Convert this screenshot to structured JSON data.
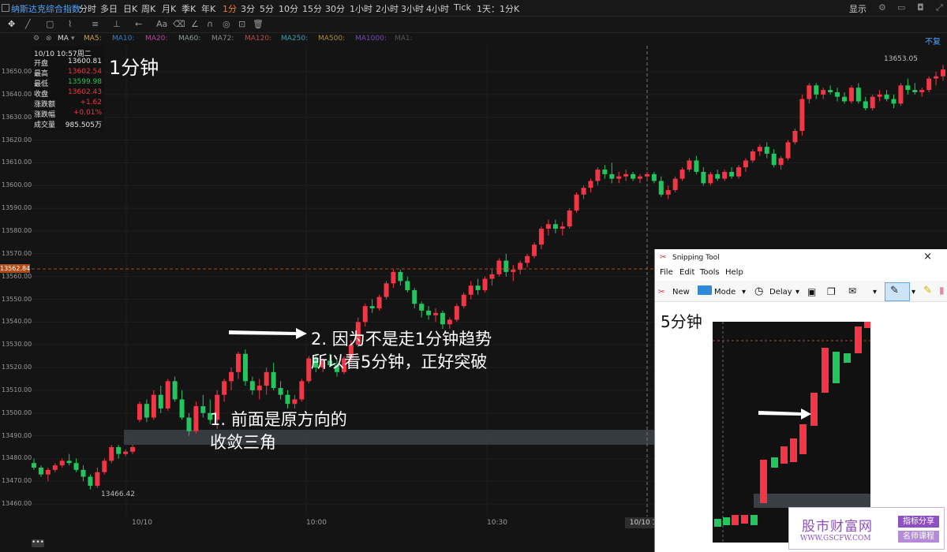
{
  "topbar": {
    "symbol": "纳斯达克综合指数",
    "timeframes": [
      "分时",
      "多日",
      "日K",
      "周K",
      "月K",
      "季K",
      "年K",
      "1分",
      "3分",
      "5分",
      "10分",
      "15分",
      "30分",
      "1小时",
      "2小时",
      "3小时",
      "4小时",
      "Tick",
      "1天：1分K"
    ],
    "active_timeframe": "1分",
    "show_label": "显示"
  },
  "mabar": {
    "indicator": "MA",
    "items": [
      {
        "label": "MA5:",
        "color": "#c8a24a"
      },
      {
        "label": "MA10:",
        "color": "#3d7fb8"
      },
      {
        "label": "MA20:",
        "color": "#b04a9a"
      },
      {
        "label": "MA60:",
        "color": "#8aa0a0"
      },
      {
        "label": "MA72:",
        "color": "#8a8a8a"
      },
      {
        "label": "MA120:",
        "color": "#b05050"
      },
      {
        "label": "MA250:",
        "color": "#3da0b0"
      },
      {
        "label": "MA500:",
        "color": "#b08a30"
      },
      {
        "label": "MA1000:",
        "color": "#7a4ab0"
      },
      {
        "label": "MA1:",
        "color": "#555555"
      }
    ],
    "right_label": "不复"
  },
  "info": {
    "date": "10/10 10:57周二",
    "rows": [
      {
        "k": "开盘",
        "v": "13600.81",
        "color": "#e6e6e6"
      },
      {
        "k": "最高",
        "v": "13602.54",
        "color": "#f23645"
      },
      {
        "k": "最低",
        "v": "13599.98",
        "color": "#22c55e"
      },
      {
        "k": "收盘",
        "v": "13602.43",
        "color": "#f23645"
      },
      {
        "k": "涨跌额",
        "v": "+1.62",
        "color": "#f23645"
      },
      {
        "k": "涨跌幅",
        "v": "+0.01%",
        "color": "#f23645"
      },
      {
        "k": "成交量",
        "v": "985.505万",
        "color": "#e6e6e6"
      }
    ]
  },
  "chart_title": "1分钟",
  "yaxis": {
    "ticks": [
      "13650.00",
      "13640.00",
      "13630.00",
      "13620.00",
      "13610.00",
      "13600.00",
      "13590.00",
      "13580.00",
      "13570.00",
      "13560.00",
      "13550.00",
      "13540.00",
      "13530.00",
      "13520.00",
      "13510.00",
      "13500.00",
      "13490.00",
      "13480.00",
      "13470.00",
      "13460.00"
    ],
    "current_price": "13562.84"
  },
  "xaxis": {
    "ticks": [
      "10/10",
      "10:00",
      "10:30"
    ],
    "cursor_label": "10/10 1"
  },
  "low_label": "13466.42",
  "high_label": "13653.05",
  "annotations": {
    "a1_line1": "1. 前面是原方向的",
    "a1_line2": "收敛三角",
    "a2_line1": "2. 因为不是走1分钟趋势",
    "a2_line2": "所以看5分钟，正好突破"
  },
  "snipping_tool": {
    "title": "Snipping Tool",
    "menus": [
      "File",
      "Edit",
      "Tools",
      "Help"
    ],
    "buttons": [
      "New",
      "Mode",
      "Delay"
    ],
    "label": "5分钟"
  },
  "watermark": {
    "name": "股市财富网",
    "url": "WWW.GSCFW.COM",
    "tag1": "指标分享",
    "tag2": "名师课程"
  },
  "chart_data": {
    "type": "candlestick",
    "title": "1分钟",
    "ylim": [
      13455,
      13661
    ],
    "up_color": "#f23645",
    "down_color": "#22c55e",
    "candles": [
      [
        13478,
        13480,
        13475,
        13476
      ],
      [
        13476,
        13477,
        13472,
        13473
      ],
      [
        13473,
        13476,
        13470,
        13475
      ],
      [
        13475,
        13478,
        13474,
        13477
      ],
      [
        13477,
        13480,
        13476,
        13479
      ],
      [
        13479,
        13482,
        13477,
        13478
      ],
      [
        13478,
        13480,
        13474,
        13475
      ],
      [
        13475,
        13477,
        13470,
        13472
      ],
      [
        13472,
        13473,
        13466.42,
        13468
      ],
      [
        13468,
        13476,
        13467,
        13474
      ],
      [
        13474,
        13480,
        13473,
        13479
      ],
      [
        13479,
        13486,
        13478,
        13485
      ],
      [
        13485,
        13486,
        13480,
        13482
      ],
      [
        13482,
        13484,
        13481,
        13483
      ],
      [
        13483,
        13486,
        13482,
        13485
      ],
      [
        13497,
        13505,
        13496,
        13504
      ],
      [
        13504,
        13506,
        13496,
        13498
      ],
      [
        13498,
        13510,
        13497,
        13508
      ],
      [
        13508,
        13512,
        13500,
        13502
      ],
      [
        13502,
        13515,
        13501,
        13514
      ],
      [
        13514,
        13516,
        13505,
        13506
      ],
      [
        13506,
        13510,
        13497,
        13498
      ],
      [
        13498,
        13500,
        13490,
        13492
      ],
      [
        13492,
        13505,
        13491,
        13503
      ],
      [
        13503,
        13508,
        13498,
        13500
      ],
      [
        13500,
        13506,
        13495,
        13497
      ],
      [
        13497,
        13510,
        13493,
        13508
      ],
      [
        13508,
        13515,
        13505,
        13514
      ],
      [
        13514,
        13520,
        13510,
        13518
      ],
      [
        13518,
        13527,
        13515,
        13526
      ],
      [
        13526,
        13528,
        13512,
        13514
      ],
      [
        13514,
        13516,
        13508,
        13510
      ],
      [
        13510,
        13515,
        13506,
        13512
      ],
      [
        13512,
        13520,
        13508,
        13518
      ],
      [
        13518,
        13522,
        13510,
        13511
      ],
      [
        13511,
        13514,
        13506,
        13508
      ],
      [
        13508,
        13510,
        13502,
        13504
      ],
      [
        13504,
        13508,
        13502,
        13506
      ],
      [
        13506,
        13515,
        13505,
        13514
      ],
      [
        13514,
        13525,
        13513,
        13524
      ],
      [
        13524,
        13526,
        13518,
        13520
      ],
      [
        13520,
        13524,
        13518,
        13523
      ],
      [
        13523,
        13526,
        13520,
        13521
      ],
      [
        13521,
        13524,
        13516,
        13518
      ],
      [
        13518,
        13525,
        13517,
        13524
      ],
      [
        13524,
        13532,
        13522,
        13530
      ],
      [
        13530,
        13542,
        13529,
        13540
      ],
      [
        13540,
        13548,
        13538,
        13547
      ],
      [
        13547,
        13550,
        13544,
        13546
      ],
      [
        13546,
        13552,
        13545,
        13551
      ],
      [
        13551,
        13558,
        13550,
        13557
      ],
      [
        13557,
        13563,
        13555,
        13562
      ],
      [
        13562,
        13563,
        13556,
        13558
      ],
      [
        13558,
        13560,
        13553,
        13554
      ],
      [
        13554,
        13555,
        13546,
        13548
      ],
      [
        13548,
        13549,
        13542,
        13545
      ],
      [
        13545,
        13547,
        13541,
        13543
      ],
      [
        13543,
        13546,
        13540,
        13544
      ],
      [
        13544,
        13545,
        13537,
        13539
      ],
      [
        13539,
        13542,
        13537,
        13541
      ],
      [
        13541,
        13548,
        13540,
        13547
      ],
      [
        13547,
        13553,
        13546,
        13552
      ],
      [
        13552,
        13558,
        13550,
        13556
      ],
      [
        13556,
        13559,
        13552,
        13554
      ],
      [
        13554,
        13560,
        13553,
        13559
      ],
      [
        13559,
        13563,
        13556,
        13561
      ],
      [
        13561,
        13568,
        13560,
        13567
      ],
      [
        13567,
        13570,
        13560,
        13562
      ],
      [
        13562,
        13565,
        13558,
        13563
      ],
      [
        13563,
        13567,
        13561,
        13566
      ],
      [
        13566,
        13570,
        13564,
        13569
      ],
      [
        13569,
        13575,
        13568,
        13574
      ],
      [
        13574,
        13582,
        13572,
        13581
      ],
      [
        13581,
        13585,
        13578,
        13583
      ],
      [
        13583,
        13585,
        13579,
        13581
      ],
      [
        13581,
        13584,
        13578,
        13582
      ],
      [
        13582,
        13590,
        13581,
        13589
      ],
      [
        13589,
        13597,
        13588,
        13596
      ],
      [
        13596,
        13600,
        13594,
        13599
      ],
      [
        13599,
        13603,
        13597,
        13602
      ],
      [
        13602,
        13608,
        13600,
        13607
      ],
      [
        13607,
        13609,
        13603,
        13605
      ],
      [
        13605,
        13610,
        13601,
        13603
      ],
      [
        13603,
        13606,
        13601,
        13604
      ],
      [
        13604,
        13607,
        13602,
        13605
      ],
      [
        13605,
        13606,
        13602,
        13603
      ],
      [
        13603,
        13605,
        13601,
        13604
      ],
      [
        13604,
        13606,
        13602,
        13605
      ],
      [
        13605,
        13606,
        13601,
        13602
      ],
      [
        13602,
        13604,
        13595,
        13596
      ],
      [
        13596,
        13600,
        13594,
        13598
      ],
      [
        13598,
        13604,
        13597,
        13603
      ],
      [
        13603,
        13608,
        13602,
        13607
      ],
      [
        13607,
        13612,
        13606,
        13611
      ],
      [
        13611,
        13613,
        13605,
        13606
      ],
      [
        13606,
        13608,
        13600,
        13601
      ],
      [
        13601,
        13606,
        13600,
        13605
      ],
      [
        13605,
        13607,
        13602,
        13603
      ],
      [
        13603,
        13607,
        13602,
        13606
      ],
      [
        13606,
        13608,
        13603,
        13604
      ],
      [
        13604,
        13609,
        13603,
        13608
      ],
      [
        13608,
        13612,
        13606,
        13611
      ],
      [
        13611,
        13616,
        13610,
        13615
      ],
      [
        13615,
        13618,
        13613,
        13617
      ],
      [
        13617,
        13619,
        13612,
        13614
      ],
      [
        13614,
        13616,
        13608,
        13609
      ],
      [
        13609,
        13613,
        13607,
        13612
      ],
      [
        13612,
        13620,
        13611,
        13619
      ],
      [
        13619,
        13625,
        13618,
        13624
      ],
      [
        13624,
        13640,
        13622,
        13638
      ],
      [
        13638,
        13645,
        13636,
        13644
      ],
      [
        13644,
        13645,
        13638,
        13640
      ],
      [
        13640,
        13643,
        13638,
        13642
      ],
      [
        13642,
        13644,
        13640,
        13641
      ],
      [
        13641,
        13643,
        13637,
        13639
      ],
      [
        13639,
        13641,
        13636,
        13637
      ],
      [
        13637,
        13644,
        13636,
        13643
      ],
      [
        13643,
        13645,
        13636,
        13637
      ],
      [
        13637,
        13639,
        13633,
        13634
      ],
      [
        13634,
        13640,
        13633,
        13639
      ],
      [
        13639,
        13642,
        13637,
        13640
      ],
      [
        13640,
        13642,
        13637,
        13638
      ],
      [
        13638,
        13640,
        13634,
        13636
      ],
      [
        13636,
        13645,
        13635,
        13644
      ],
      [
        13644,
        13647,
        13640,
        13642
      ],
      [
        13642,
        13645,
        13640,
        13641
      ],
      [
        13641,
        13643,
        13639,
        13642
      ],
      [
        13642,
        13648,
        13641,
        13647
      ],
      [
        13647,
        13650,
        13644,
        13648
      ],
      [
        13648,
        13653.05,
        13646,
        13651
      ]
    ]
  }
}
